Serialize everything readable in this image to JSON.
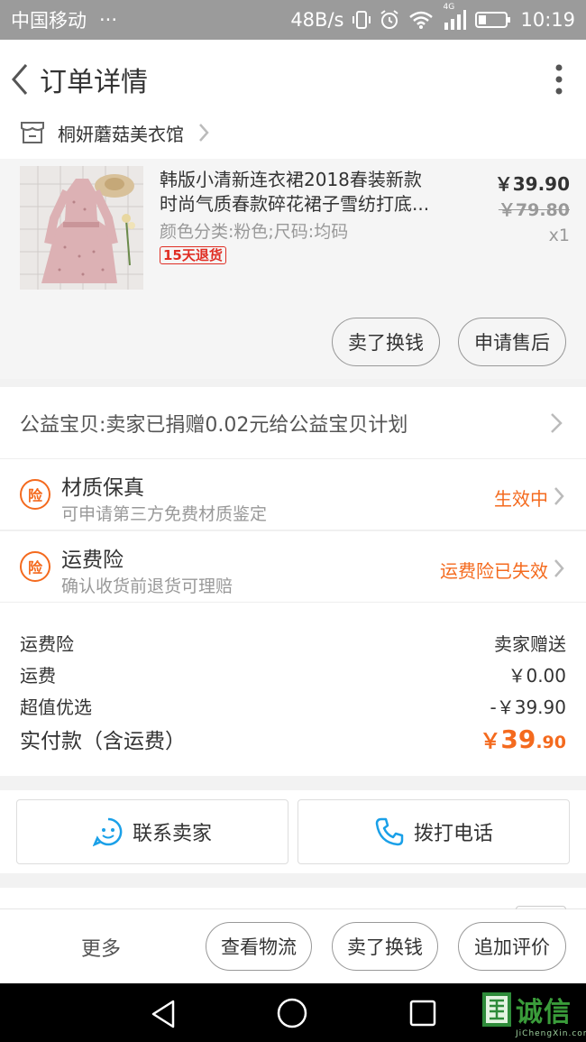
{
  "status_bar": {
    "carrier": "中国移动",
    "carrier_dots": "···",
    "net_speed": "48B/s",
    "network_type": "4G",
    "time": "10:19",
    "icons": [
      "vibrate-icon",
      "alarm-icon",
      "wifi-icon",
      "signal-icon",
      "battery-icon"
    ]
  },
  "header": {
    "title": "订单详情",
    "back_icon": "chevron-left-icon",
    "more_icon": "more-vertical-icon"
  },
  "shop": {
    "name": "桐妍蘑菇美衣馆",
    "icon": "shop-icon"
  },
  "product": {
    "title_line1": "韩版小清新连衣裙2018春装新款",
    "title_line2": "时尚气质春款碎花裙子雪纺打底...",
    "sku": "颜色分类:粉色;尺码:均码",
    "badge": "15天退货",
    "price_now": "￥39.90",
    "price_old": "￥79.80",
    "quantity": "x1",
    "buttons": {
      "sell_exchange": "卖了换钱",
      "after_sale": "申请售后"
    }
  },
  "charity": {
    "text": "公益宝贝:卖家已捐赠0.02元给公益宝贝计划"
  },
  "insurance": [
    {
      "icon_text": "险",
      "title": "材质保真",
      "subtitle": "可申请第三方免费材质鉴定",
      "status": "生效中"
    },
    {
      "icon_text": "险",
      "title": "运费险",
      "subtitle": "确认收货前退货可理赔",
      "status": "运费险已失效"
    }
  ],
  "summary": {
    "rows": [
      {
        "label": "运费险",
        "value": "卖家赠送"
      },
      {
        "label": "运费",
        "value": "￥0.00"
      },
      {
        "label": "超值优选",
        "value": "-￥39.90"
      }
    ],
    "total_label": "实付款（含运费）",
    "total_currency": "￥",
    "total_integer": "39",
    "total_decimal": ".90"
  },
  "contact": {
    "seller_label": "联系卖家",
    "phone_label": "拨打电话"
  },
  "actions": {
    "more": "更多",
    "logistics": "查看物流",
    "sell_exchange": "卖了换钱",
    "add_review": "追加评价"
  },
  "watermark": {
    "text": "诚信",
    "sub": "JiChengXin.com"
  },
  "colors": {
    "accent_orange": "#f46a1e",
    "badge_red": "#e02e24",
    "contact_blue": "#1aa0e8"
  }
}
